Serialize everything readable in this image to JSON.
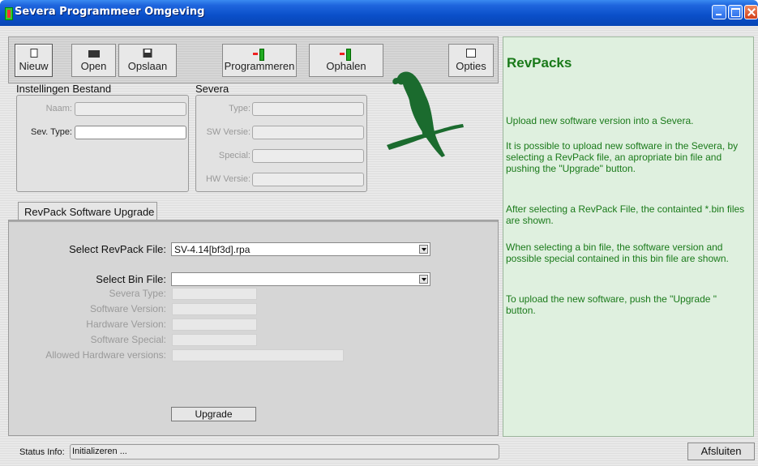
{
  "window": {
    "title": "Severa Programmeer Omgeving"
  },
  "toolbar": {
    "new_label": "Nieuw",
    "open_label": "Open",
    "save_label": "Opslaan",
    "program_label": "Programmeren",
    "fetch_label": "Ophalen",
    "options_label": "Opties"
  },
  "settings": {
    "group_label": "Instellingen Bestand",
    "name_label": "Naam:",
    "sev_type_label": "Sev. Type:"
  },
  "severa": {
    "group_label": "Severa",
    "type_label": "Type:",
    "sw_version_label": "SW Versie:",
    "special_label": "Special:",
    "hw_version_label": "HW Versie:"
  },
  "upgrade": {
    "tab_label": "RevPack Software Upgrade",
    "revpack_label": "Select RevPack File:",
    "revpack_value": "SV-4.14[bf3d].rpa",
    "bin_label": "Select Bin File:",
    "bin_value": "",
    "severa_type_label": "Severa Type:",
    "software_version_label": "Software Version:",
    "hardware_version_label": "Hardware Version:",
    "software_special_label": "Software Special:",
    "allowed_hw_label": "Allowed Hardware versions:",
    "upgrade_button": "Upgrade"
  },
  "status": {
    "label": "Status Info:",
    "value": "Initializeren ..."
  },
  "close_button": "Afsluiten",
  "help": {
    "title": "RevPacks",
    "p1": "Upload new software version into a Severa.",
    "p2": "It is possible to upload new software in the Severa, by selecting a RevPack file, an apropriate bin file and pushing the \"Upgrade\" button.",
    "p3": "After selecting a RevPack File, the containted *.bin files are shown.",
    "p4": "When selecting a bin file, the software version and possible special contained in this bin file are shown.",
    "p5": "To upload the new software, push the \"Upgrade \" button."
  },
  "colors": {
    "titlebar": "#0a4fc9",
    "help_text": "#1a7a1a",
    "help_background": "#dff0df",
    "parrot": "#1b6b2e"
  },
  "icons": [
    "app-icon",
    "new-page-icon",
    "open-folder-icon",
    "save-disk-icon",
    "program-icon",
    "fetch-icon",
    "options-icon",
    "parrot-logo",
    "dropdown-arrow-icon"
  ]
}
